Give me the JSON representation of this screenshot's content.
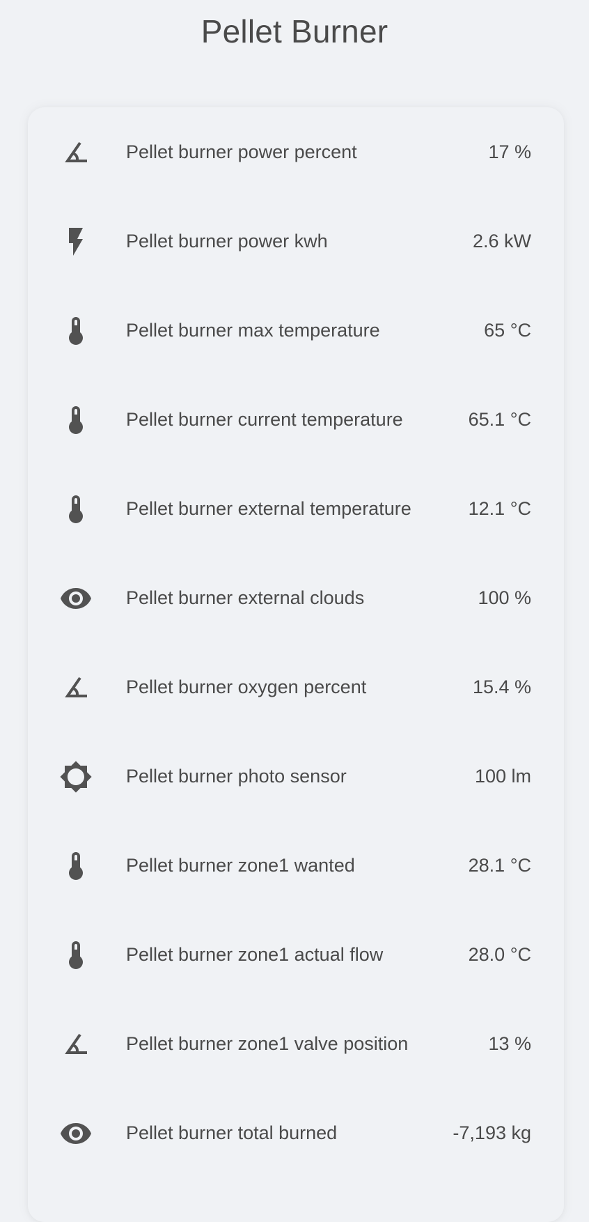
{
  "title": "Pellet Burner",
  "colors": {
    "background": "#f0f2f5",
    "text": "#4a4a4a",
    "icon": "#525252"
  },
  "entities": [
    {
      "icon": "angle-acute-icon",
      "label": "Pellet burner power percent",
      "value": "17 %"
    },
    {
      "icon": "flash-icon",
      "label": "Pellet burner power kwh",
      "value": "2.6 kW"
    },
    {
      "icon": "thermometer-icon",
      "label": "Pellet burner max temperature",
      "value": "65 °C"
    },
    {
      "icon": "thermometer-icon",
      "label": "Pellet burner current temperature",
      "value": "65.1 °C"
    },
    {
      "icon": "thermometer-icon",
      "label": "Pellet burner external temperature",
      "value": "12.1 °C"
    },
    {
      "icon": "eye-icon",
      "label": "Pellet burner external clouds",
      "value": "100 %"
    },
    {
      "icon": "angle-acute-icon",
      "label": "Pellet burner oxygen percent",
      "value": "15.4 %"
    },
    {
      "icon": "brightness-icon",
      "label": "Pellet burner photo sensor",
      "value": "100 lm"
    },
    {
      "icon": "thermometer-icon",
      "label": "Pellet burner zone1 wanted",
      "value": "28.1 °C"
    },
    {
      "icon": "thermometer-icon",
      "label": "Pellet burner zone1 actual flow",
      "value": "28.0 °C"
    },
    {
      "icon": "angle-acute-icon",
      "label": "Pellet burner zone1 valve position",
      "value": "13 %"
    },
    {
      "icon": "eye-icon",
      "label": "Pellet burner total burned",
      "value": "-7,193 kg"
    }
  ]
}
